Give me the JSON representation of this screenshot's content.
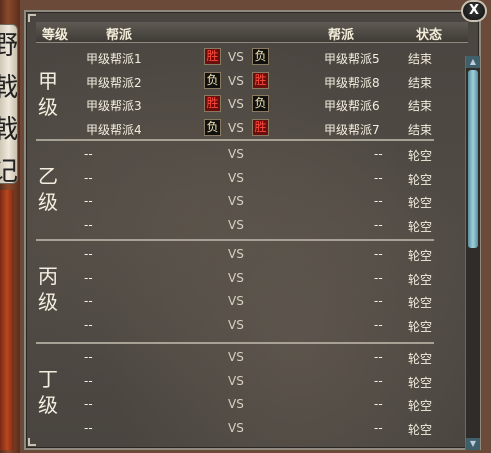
{
  "side_scroll_text": [
    "野",
    "戟",
    "戟",
    "记"
  ],
  "close_label": "X",
  "header": {
    "grade": "等级",
    "guild1": "帮派",
    "guild2": "帮派",
    "status": "状态"
  },
  "vs_label": "VS",
  "colors": {
    "win": "#ff4a3a",
    "loss": "#f1e4b0",
    "text": "#f3eedf"
  },
  "groups": [
    {
      "tier": [
        "甲",
        "级"
      ],
      "rows": [
        {
          "left": "甲级帮派1",
          "left_result": "胜",
          "right_result": "负",
          "right": "甲级帮派5",
          "status": "结束"
        },
        {
          "left": "甲级帮派2",
          "left_result": "负",
          "right_result": "胜",
          "right": "甲级帮派8",
          "status": "结束"
        },
        {
          "left": "甲级帮派3",
          "left_result": "胜",
          "right_result": "负",
          "right": "甲级帮派6",
          "status": "结束"
        },
        {
          "left": "甲级帮派4",
          "left_result": "负",
          "right_result": "胜",
          "right": "甲级帮派7",
          "status": "结束"
        }
      ]
    },
    {
      "tier": [
        "乙",
        "级"
      ],
      "rows": [
        {
          "left": "--",
          "right": "--",
          "status": "轮空"
        },
        {
          "left": "--",
          "right": "--",
          "status": "轮空"
        },
        {
          "left": "--",
          "right": "--",
          "status": "轮空"
        },
        {
          "left": "--",
          "right": "--",
          "status": "轮空"
        }
      ]
    },
    {
      "tier": [
        "丙",
        "级"
      ],
      "rows": [
        {
          "left": "--",
          "right": "--",
          "status": "轮空"
        },
        {
          "left": "--",
          "right": "--",
          "status": "轮空"
        },
        {
          "left": "--",
          "right": "--",
          "status": "轮空"
        },
        {
          "left": "--",
          "right": "--",
          "status": "轮空"
        }
      ]
    },
    {
      "tier": [
        "丁",
        "级"
      ],
      "rows": [
        {
          "left": "--",
          "right": "--",
          "status": "轮空"
        },
        {
          "left": "--",
          "right": "--",
          "status": "轮空"
        },
        {
          "left": "--",
          "right": "--",
          "status": "轮空"
        },
        {
          "left": "--",
          "right": "--",
          "status": "轮空"
        }
      ]
    }
  ]
}
